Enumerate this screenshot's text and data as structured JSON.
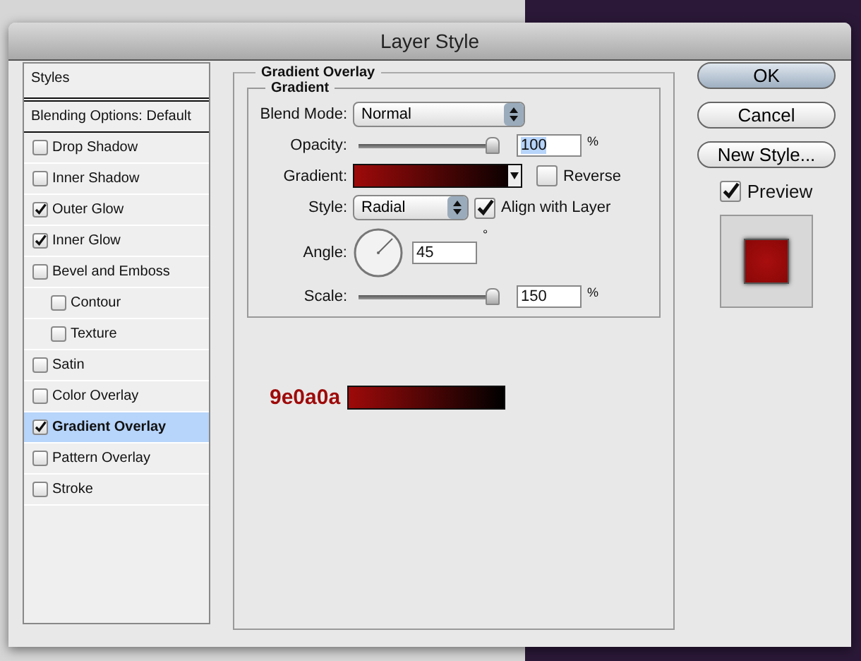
{
  "window": {
    "title": "Layer Style"
  },
  "styles_list": {
    "header": "Styles",
    "blending": "Blending Options: Default",
    "items": [
      {
        "label": "Drop Shadow",
        "checked": false,
        "selected": false
      },
      {
        "label": "Inner Shadow",
        "checked": false,
        "selected": false
      },
      {
        "label": "Outer Glow",
        "checked": true,
        "selected": false
      },
      {
        "label": "Inner Glow",
        "checked": true,
        "selected": false
      },
      {
        "label": "Bevel and Emboss",
        "checked": false,
        "selected": false,
        "children": [
          {
            "label": "Contour",
            "checked": false,
            "selected": false
          },
          {
            "label": "Texture",
            "checked": false,
            "selected": false
          }
        ]
      },
      {
        "label": "Satin",
        "checked": false,
        "selected": false
      },
      {
        "label": "Color Overlay",
        "checked": false,
        "selected": false
      },
      {
        "label": "Gradient Overlay",
        "checked": true,
        "selected": true
      },
      {
        "label": "Pattern Overlay",
        "checked": false,
        "selected": false
      },
      {
        "label": "Stroke",
        "checked": false,
        "selected": false
      }
    ]
  },
  "panel": {
    "title": "Gradient Overlay",
    "group_title": "Gradient",
    "blend_mode": {
      "label": "Blend Mode:",
      "value": "Normal"
    },
    "opacity": {
      "label": "Opacity:",
      "level": 1,
      "value": "100",
      "unit": "%"
    },
    "gradient": {
      "label": "Gradient:"
    },
    "reverse": {
      "label": "Reverse",
      "checked": false
    },
    "style": {
      "label": "Style:",
      "value": "Radial"
    },
    "align": {
      "label": "Align with Layer",
      "checked": true
    },
    "angle": {
      "label": "Angle:",
      "value": "45",
      "unit": "°"
    },
    "scale": {
      "label": "Scale:",
      "level": 1,
      "value": "150",
      "unit": "%"
    },
    "swatch": {
      "label": "9e0a0a"
    }
  },
  "buttons": [
    {
      "label": "OK",
      "default": true
    },
    {
      "label": "Cancel",
      "default": false
    },
    {
      "label": "New Style...",
      "default": false
    }
  ],
  "preview": {
    "label": "Preview",
    "checked": true
  }
}
